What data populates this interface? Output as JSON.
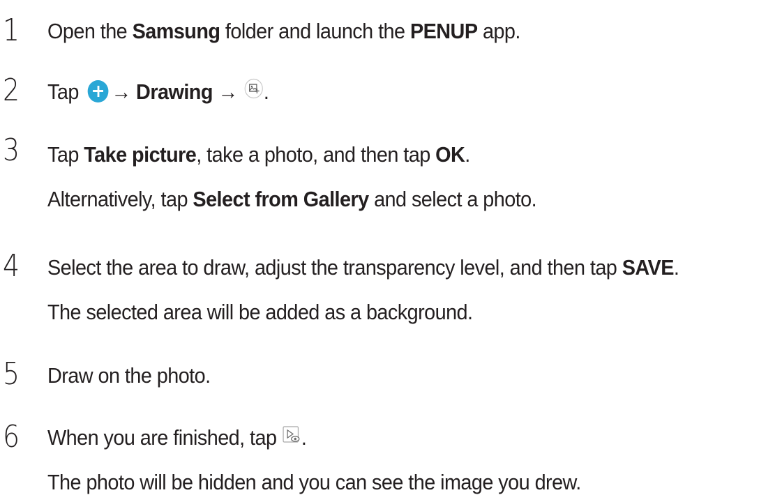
{
  "steps": [
    {
      "number": "1",
      "parts": [
        "Open the ",
        "Samsung",
        " folder and launch the ",
        "PENUP",
        " app."
      ]
    },
    {
      "number": "2",
      "parts": [
        "Tap ",
        "→ ",
        "Drawing",
        " → ",
        "."
      ],
      "icons": [
        "add-circle-icon",
        "image-background-icon"
      ]
    },
    {
      "number": "3",
      "parts": [
        "Tap ",
        "Take picture",
        ", take a photo, and then tap ",
        "OK",
        "."
      ],
      "sub_parts": [
        "Alternatively, tap ",
        "Select from Gallery",
        " and select a photo."
      ]
    },
    {
      "number": "4",
      "parts": [
        "Select the area to draw, adjust the transparency level, and then tap ",
        "SAVE",
        "."
      ],
      "sub": "The selected area will be added as a background."
    },
    {
      "number": "5",
      "text": "Draw on the photo."
    },
    {
      "number": "6",
      "text": "When you are finished, tap ",
      "after_icon": ".",
      "icons": [
        "hide-photo-icon"
      ],
      "sub": "The photo will be hidden and you can see the image you drew."
    }
  ],
  "colors": {
    "text": "#231f20",
    "accent": "#2aa7d6"
  }
}
